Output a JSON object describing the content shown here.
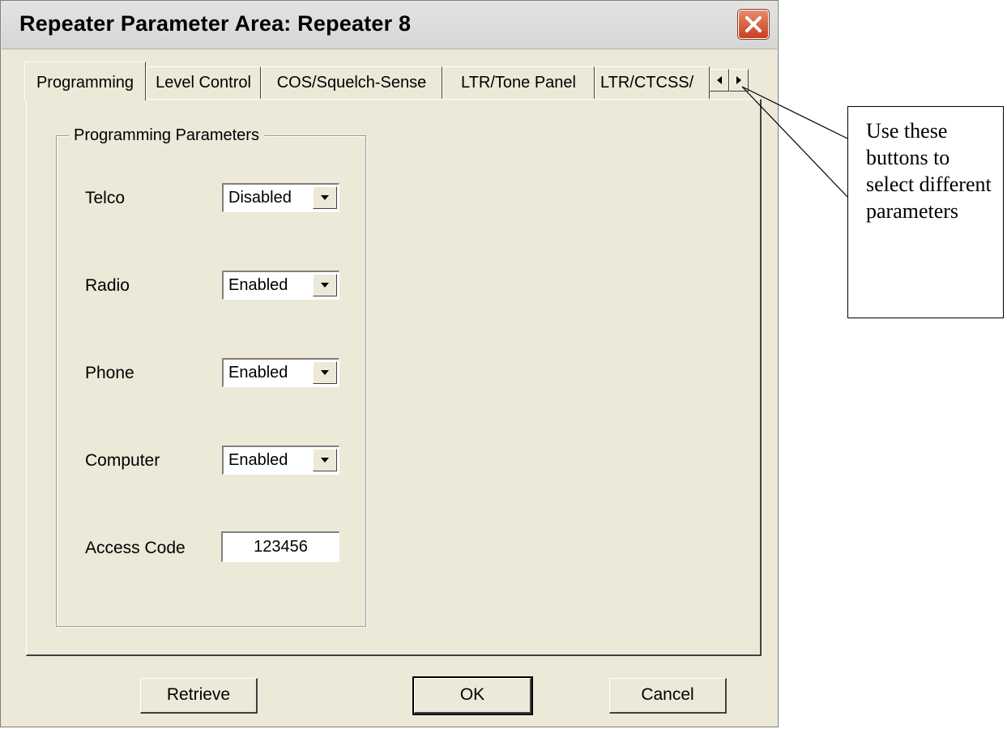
{
  "window": {
    "title": "Repeater Parameter Area:  Repeater 8",
    "close_label": "close"
  },
  "tabs": [
    {
      "label": "Programming",
      "active": true
    },
    {
      "label": "Level Control",
      "active": false
    },
    {
      "label": "COS/Squelch-Sense",
      "active": false
    },
    {
      "label": "LTR/Tone Panel",
      "active": false
    },
    {
      "label": "LTR/CTCSS/",
      "active": false
    }
  ],
  "tab_scroll": {
    "left_icon": "arrow-left-icon",
    "right_icon": "arrow-right-icon"
  },
  "group": {
    "title": "Programming Parameters",
    "fields": {
      "telco": {
        "label": "Telco",
        "value": "Disabled"
      },
      "radio": {
        "label": "Radio",
        "value": "Enabled"
      },
      "phone": {
        "label": "Phone",
        "value": "Enabled"
      },
      "computer": {
        "label": "Computer",
        "value": "Enabled"
      },
      "access_code": {
        "label": "Access Code",
        "value": "123456"
      }
    }
  },
  "buttons": {
    "retrieve": "Retrieve",
    "ok": "OK",
    "cancel": "Cancel"
  },
  "annotation": {
    "text": "Use these buttons to select different parameters"
  }
}
